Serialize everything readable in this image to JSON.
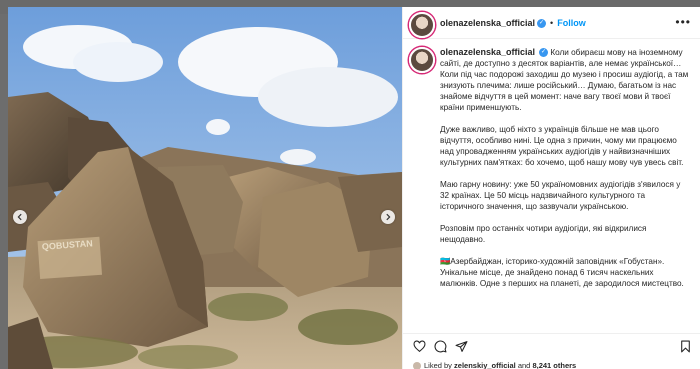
{
  "header": {
    "username": "olenazelenska_official",
    "separator": "•",
    "follow_label": "Follow",
    "more_icon": "more-horizontal-icon"
  },
  "caption": {
    "username": "olenazelenska_official",
    "paragraphs": [
      "Коли обираєш мову на іноземному сайті, де доступно з десяток варіантів, але немає української… Коли під час подорожі заходиш до музею і просиш аудіогід, а там знизують плечима: лише російський… Думаю, багатьом із нас знайоме відчуття в цей момент: наче вагу твоєї мови й твоєї країни применшують.",
      "Дуже важливо, щоб ніхто з українців більше не мав цього відчуття, особливо нині. Це одна з причин, чому ми працюємо над упровадженням українських аудіогідів у найвизначніших культурних пам'ятках: бо хочемо, щоб нашу мову чув увесь світ.",
      "Маю гарну новину: уже 50 україномовних аудіогідів з'явилося у 32 країнах. Це 50 місць надзвичайного культурного та історичного значення, що зазвучали українською.",
      "Розповім про останніх чотири аудіогіди, які відкрилися нещодавно.",
      "🇦🇿Азербайджан, історико-художній заповідник «Гобустан». Унікальне місце, де знайдено понад 6 тисяч наскельних малюнків. Одне з перших на планеті, де зародилося мистецтво."
    ]
  },
  "photo": {
    "sign_text": "QOBUSTAN"
  },
  "liked": {
    "prefix": "Liked by",
    "user": "zelenskiy_official",
    "middle": "and",
    "count": "8,241 others"
  },
  "icons": [
    "heart-icon",
    "comment-icon",
    "share-icon",
    "bookmark-icon",
    "chevron-left-icon",
    "chevron-right-icon"
  ]
}
